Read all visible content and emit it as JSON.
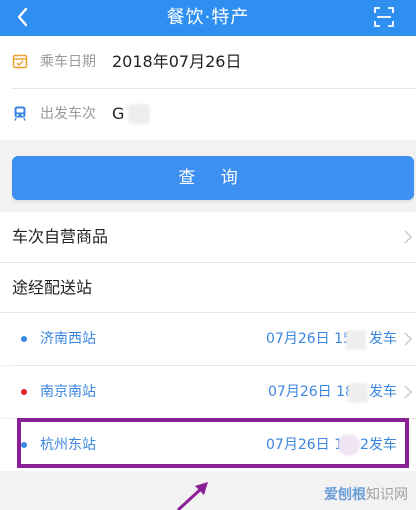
{
  "header": {
    "back_icon": "chevron-left-icon",
    "title": "餐饮·特产",
    "scan_icon": "scan-icon"
  },
  "form": {
    "date_label": "乘车日期",
    "date_value": "2018年07月26日",
    "train_label": "出发车次",
    "train_value": "G",
    "query_button": "查 询"
  },
  "sections": {
    "products_title": "车次自营商品",
    "stations_title": "途经配送站"
  },
  "stations": [
    {
      "name": "济南西站",
      "time": "07月26日 15",
      "depart": "发车",
      "dot_color": "#3b86e0"
    },
    {
      "name": "南京南站",
      "time": "07月26日 18",
      "depart": "发车",
      "dot_color": "#e02020"
    },
    {
      "name": "杭州东站",
      "time": "07月26日 1",
      "time_tail": "2发车",
      "dot_color": "#3b86e0"
    }
  ],
  "colors": {
    "primary": "#2f8ff0",
    "highlight": "#8a1f96"
  },
  "watermark": {
    "part1": "爱刨根",
    "part2": "知识网"
  }
}
